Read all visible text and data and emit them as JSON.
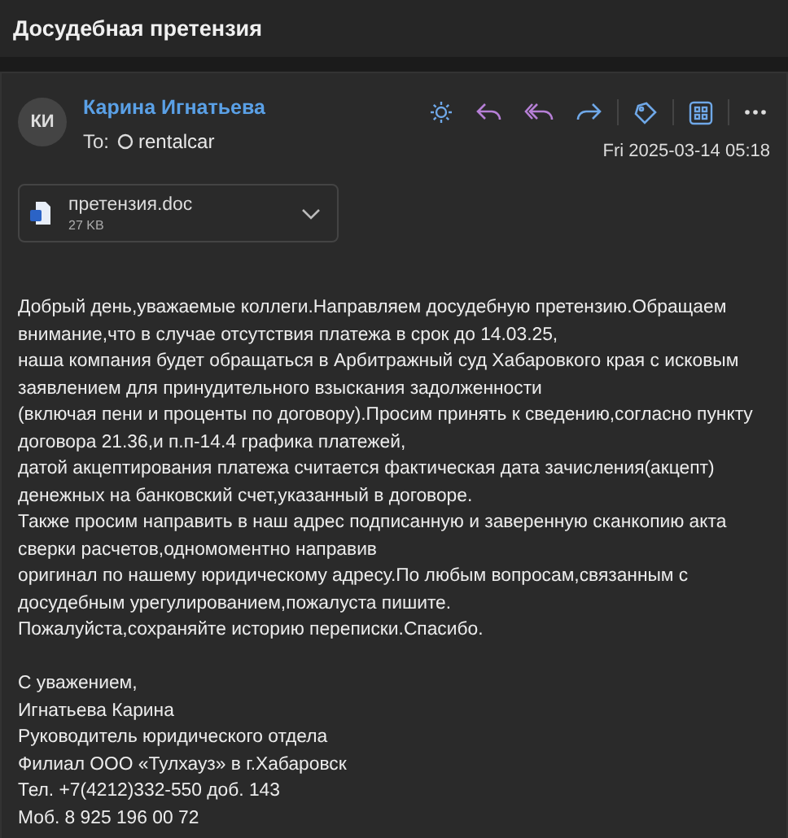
{
  "window": {
    "title": "Досудебная претензия"
  },
  "message": {
    "avatar": "КИ",
    "sender": "Карина Игнатьева",
    "to_label": "To:",
    "recipient": "rentalcar",
    "date": "Fri 2025-03-14 05:18",
    "toolbar": [
      {
        "kind": "sun"
      },
      {
        "kind": "reply"
      },
      {
        "kind": "reply_all"
      },
      {
        "kind": "forward"
      },
      {
        "kind": "sep"
      },
      {
        "kind": "tag"
      },
      {
        "kind": "sep"
      },
      {
        "kind": "apps"
      },
      {
        "kind": "sep"
      },
      {
        "kind": "more"
      }
    ],
    "attachment": {
      "name": "претензия.doc",
      "size": "27 KB"
    },
    "body": [
      "Добрый день,уважаемые коллеги.Направляем досудебную претензию.Обращаем",
      "внимание,что в случае отсутствия платежа в срок до 14.03.25,",
      "наша компания будет обращаться в Арбитражный суд Хабаровкого края с исковым",
      "заявлением для принудительного взыскания задолженности",
      "(включая пени и проценты по договору).Просим принять к сведению,согласно пункту",
      "договора 21.36,и п.п-14.4 графика платежей,",
      "датой акцептирования платежа считается фактическая дата зачисления(акцепт)",
      "денежных на банковский счет,указанный в договоре.",
      "Также просим направить в наш адрес подписанную и заверенную сканкопию акта",
      "сверки расчетов,одномоментно направив",
      "оригинал по нашему юридическому адресу.По любым вопросам,связанным с",
      "досудебным урегулированием,пожалуста пишите.",
      "Пожалуйста,сохраняйте историю переписки.Спасибо."
    ],
    "signature": [
      "С уважением,",
      "Игнатьева Карина",
      "Руководитель юридического отдела",
      "Филиал ООО «Тулхауз» в г.Хабаровск",
      "Тел. +7(4212)332-550 доб. 143",
      "Моб. 8 925 196 00 72"
    ]
  }
}
